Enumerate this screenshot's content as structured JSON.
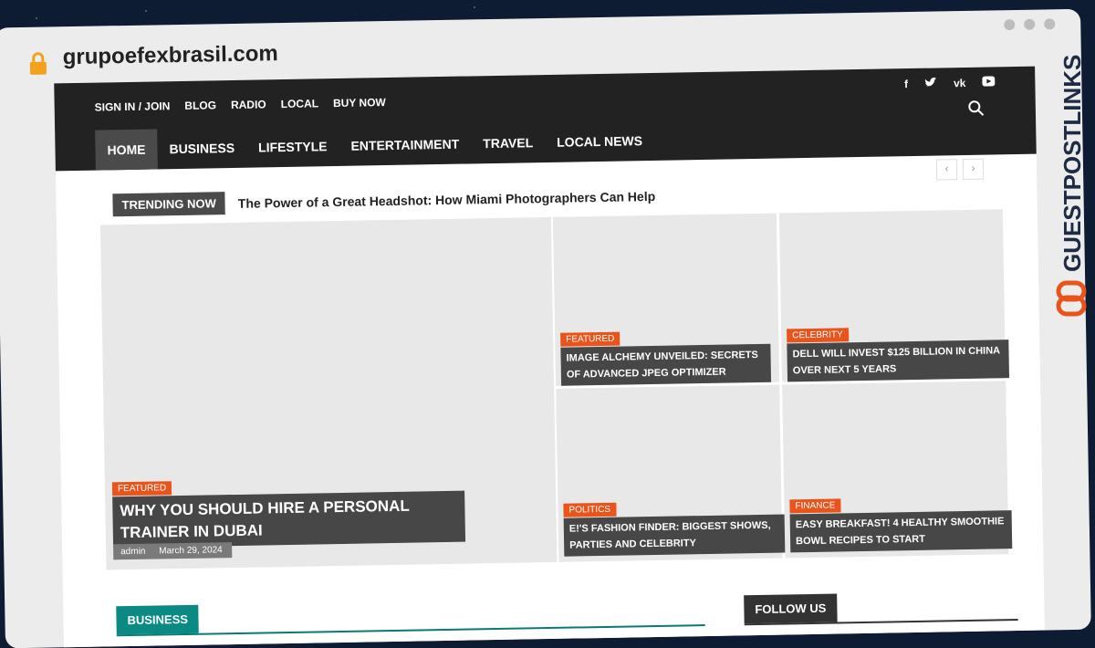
{
  "browser": {
    "url": "grupoefexbrasil.com"
  },
  "top_links": [
    "SIGN IN / JOIN",
    "BLOG",
    "RADIO",
    "LOCAL",
    "BUY NOW"
  ],
  "social_icons": [
    "facebook-icon",
    "twitter-icon",
    "vk-icon",
    "youtube-icon"
  ],
  "main_nav": [
    "HOME",
    "BUSINESS",
    "LIFESTYLE",
    "ENTERTAINMENT",
    "TRAVEL",
    "LOCAL NEWS"
  ],
  "trending": {
    "label": "TRENDING NOW",
    "headline": "The Power of a Great Headshot: How Miami Photographers Can Help"
  },
  "featured": [
    {
      "category": "FEATURED",
      "title": "WHY YOU SHOULD HIRE A PERSONAL TRAINER IN DUBAI",
      "author": "admin",
      "sep": "-",
      "date": "March 29, 2024"
    },
    {
      "category": "FEATURED",
      "title": "IMAGE ALCHEMY UNVEILED: SECRETS OF ADVANCED JPEG OPTIMIZER"
    },
    {
      "category": "CELEBRITY",
      "title": "DELL WILL INVEST $125 BILLION IN CHINA OVER NEXT 5 YEARS"
    },
    {
      "category": "POLITICS",
      "title": "E!'S FASHION FINDER: BIGGEST SHOWS, PARTIES AND CELEBRITY"
    },
    {
      "category": "FINANCE",
      "title": "EASY BREAKFAST! 4 HEALTHY SMOOTHIE BOWL RECIPES TO START"
    }
  ],
  "sections": {
    "business": "BUSINESS",
    "follow": "FOLLOW US"
  },
  "brand": {
    "name": "GUESTPOSTLINKS"
  },
  "colors": {
    "accent": "#e9541c",
    "teal": "#0a8a82",
    "nav": "#222222"
  }
}
